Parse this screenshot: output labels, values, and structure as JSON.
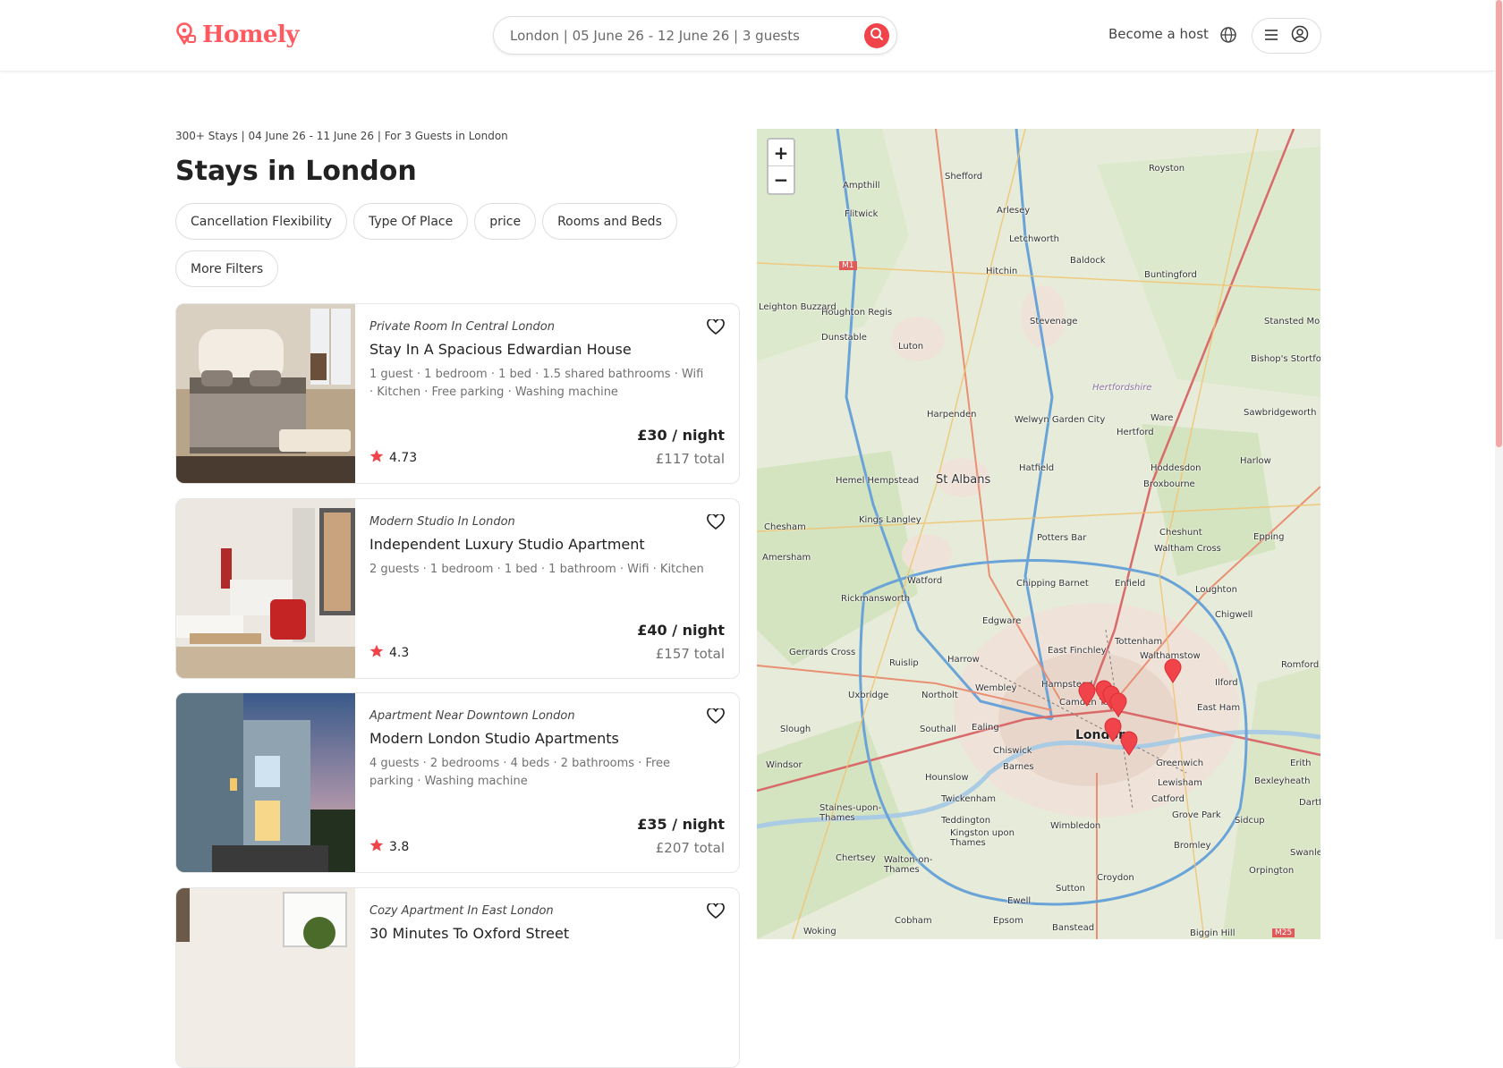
{
  "header": {
    "brand": "Homely",
    "search_text": "London | 05 June 26 - 12 June 26 | 3 guests",
    "host_link": "Become a host",
    "brand_color": "#ff5a5f",
    "accent_color": "#f0434a"
  },
  "results": {
    "summary": "300+ Stays | 04 June 26 - 11 June 26 | For 3 Guests in London",
    "title": "Stays in London"
  },
  "filters": [
    "Cancellation Flexibility",
    "Type Of Place",
    "price",
    "Rooms and Beds",
    "More Filters"
  ],
  "listings": [
    {
      "type": "Private Room In Central London",
      "title": "Stay In A Spacious Edwardian House",
      "amenities": "1 guest · 1 bedroom · 1 bed · 1.5 shared bathrooms · Wifi · Kitchen · Free parking · Washing machine",
      "rating": "4.73",
      "price": "£30 / night",
      "total": "£117 total"
    },
    {
      "type": "Modern Studio In London",
      "title": "Independent Luxury Studio Apartment",
      "amenities": "2 guests · 1 bedroom · 1 bed · 1 bathroom · Wifi · Kitchen",
      "rating": "4.3",
      "price": "£40 / night",
      "total": "£157 total"
    },
    {
      "type": "Apartment Near Downtown London",
      "title": "Modern London Studio Apartments",
      "amenities": "4 guests · 2 bedrooms · 4 beds · 2 bathrooms · Free parking · Washing machine",
      "rating": "3.8",
      "price": "£35 / night",
      "total": "£207 total"
    },
    {
      "type": "Cozy Apartment In East London",
      "title": "30 Minutes To Oxford Street",
      "amenities": "",
      "rating": "",
      "price": "",
      "total": ""
    }
  ],
  "map": {
    "zoom_in": "+",
    "zoom_out": "−",
    "labels": [
      "Shefford",
      "Royston",
      "Ampthill",
      "Flitwick",
      "Arlesey",
      "Letchworth",
      "Hitchin",
      "Baldock",
      "Buntingford",
      "Houghton Regis",
      "Dunstable",
      "Luton",
      "Stevenage",
      "Hertfordshire",
      "Bishop's Stortford",
      "Harpenden",
      "Welwyn Garden City",
      "Ware",
      "Hertford",
      "Sawbridgeworth",
      "Hemel Hempstead",
      "St Albans",
      "Hatfield",
      "Hoddesdon",
      "Broxbourne",
      "Harlow",
      "Chesham",
      "Kings Langley",
      "Potters Bar",
      "Cheshunt",
      "Waltham Cross",
      "Epping",
      "Amersham",
      "Watford",
      "Chipping Barnet",
      "Enfield",
      "Loughton",
      "Rickmansworth",
      "Chigwell",
      "Edgware",
      "Gerrards Cross",
      "East Finchley",
      "Tottenham",
      "Walthamstow",
      "Romford",
      "Ruislip",
      "Harrow",
      "Hampstead",
      "Ilford",
      "Uxbridge",
      "Northolt",
      "Wembley",
      "Camden Town",
      "East Ham",
      "Slough",
      "Southall",
      "Ealing",
      "London",
      "Chiswick",
      "Greenwich",
      "Erith",
      "Windsor",
      "Hounslow",
      "Barnes",
      "Lewisham",
      "Bexleyheath",
      "Twickenham",
      "Catford",
      "Staines-upon-Thames",
      "Teddington",
      "Kingston upon Thames",
      "Wimbledon",
      "Grove Park",
      "Sidcup",
      "Bromley",
      "Swanley",
      "Chertsey",
      "Walton-on-Thames",
      "Croydon",
      "Orpington",
      "Sutton",
      "Ewell",
      "Cobham",
      "Epsom",
      "Banstead",
      "Woking",
      "Biggin Hill",
      "Stansted Mountfitchet",
      "Leighton Buzzard",
      "Dartford",
      "M1",
      "M25"
    ]
  }
}
